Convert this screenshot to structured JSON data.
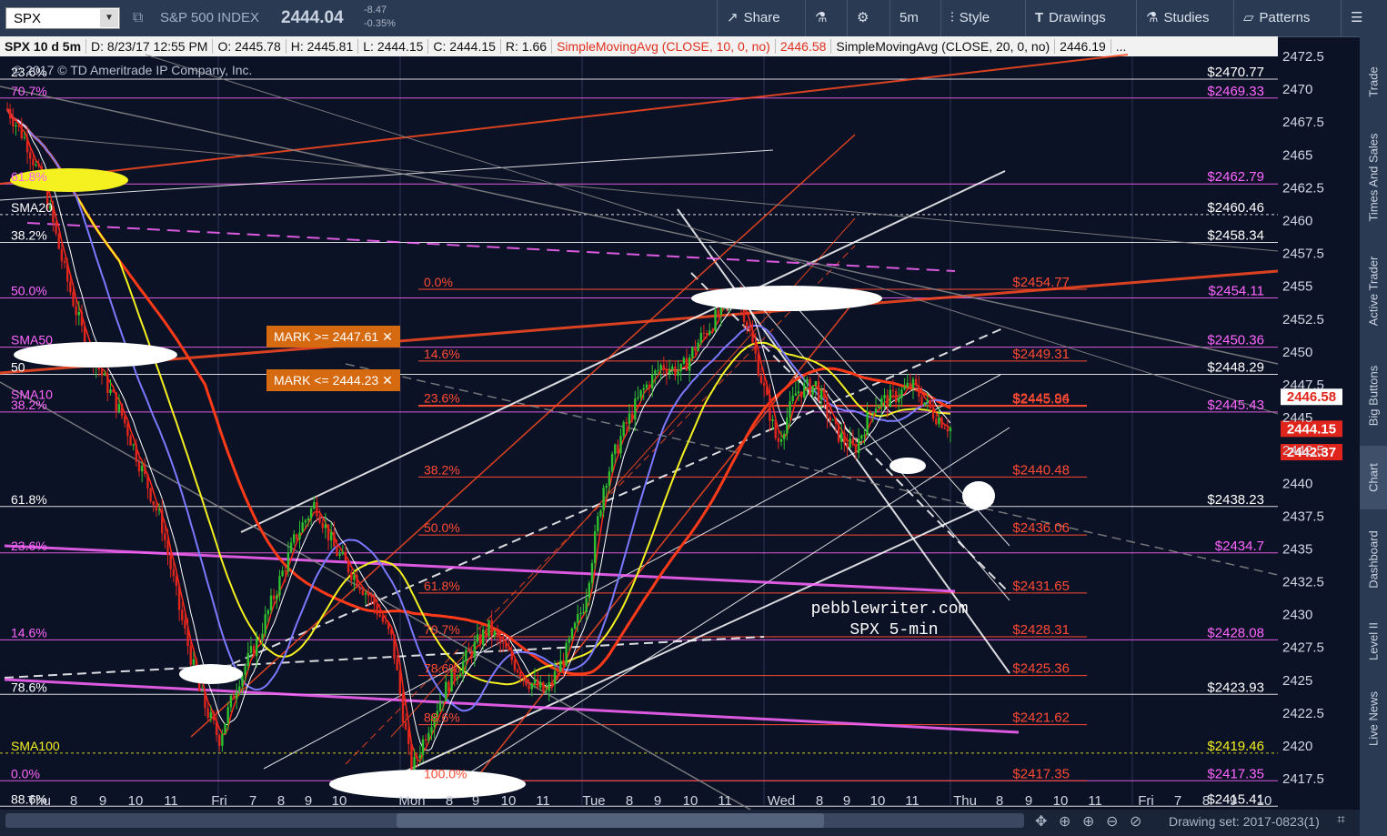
{
  "toolbar": {
    "symbol": "SPX",
    "description": "S&P 500 INDEX",
    "last": "2444.04",
    "change": "-8.47",
    "change_pct": "-0.35%",
    "buttons": {
      "share": "Share",
      "interval": "5m",
      "style": "Style",
      "drawings": "Drawings",
      "studies": "Studies",
      "patterns": "Patterns"
    }
  },
  "info_bar": {
    "symbol": "SPX 10 d 5m",
    "date": "D: 8/23/17 12:55 PM",
    "open": "O: 2445.78",
    "high": "H: 2445.81",
    "low": "L: 2444.15",
    "close": "C: 2444.15",
    "range": "R: 1.66",
    "sma10_label": "SimpleMovingAvg (CLOSE, 10, 0, no)",
    "sma10_value": "2446.58",
    "sma20_label": "SimpleMovingAvg (CLOSE, 20, 0, no)",
    "sma20_value": "2446.19",
    "more": "..."
  },
  "copyright": "© 2017 © TD Ameritrade IP Company, Inc.",
  "watermark": {
    "line1": "pebblewriter.com",
    "line2": "SPX 5-min"
  },
  "orders": {
    "upper": "MARK >= 2447.61",
    "lower": "MARK <= 2444.23"
  },
  "sidebar": [
    "Trade",
    "Times And Sales",
    "Active Trader",
    "Big Buttons",
    "Chart",
    "Dashboard",
    "Level II",
    "Live News"
  ],
  "drawing_set": "Drawing set: 2017-0823(1)",
  "colors": {
    "background": "#0c1226",
    "sma10": "#ff2a1a",
    "sma20": "#ffffff",
    "sma50": "#7b79ff",
    "sma100": "#f5f020",
    "sma_long": "#ff3a18",
    "fib_red": "#ff4a33",
    "fib_magenta": "#ff66ff",
    "bull": "#2fbf2f",
    "bear": "#e0261c",
    "order": "#d66a10"
  },
  "chart_data": {
    "type": "candlestick",
    "symbol": "SPX",
    "interval": "5m",
    "ylim": [
      2415.5,
      2472.5
    ],
    "y_ticks": [
      2417.5,
      2420,
      2422.5,
      2425,
      2427.5,
      2430,
      2432.5,
      2435,
      2437.5,
      2440,
      2442.5,
      2445,
      2447.5,
      2450,
      2452.5,
      2455,
      2457.5,
      2460,
      2462.5,
      2465,
      2467.5,
      2470,
      2472.5
    ],
    "x_labels": [
      "Thu",
      "8",
      "9",
      "10",
      "11",
      "Fri",
      "7",
      "8",
      "9",
      "10",
      "Mon",
      "8",
      "9",
      "10",
      "11",
      "Tue",
      "8",
      "9",
      "10",
      "11",
      "Wed",
      "8",
      "9",
      "10",
      "11",
      "Thu",
      "8",
      "9",
      "10",
      "11",
      "Fri",
      "7",
      "8",
      "9",
      "10"
    ],
    "price_path": [
      2468.5,
      2466,
      2462,
      2456,
      2451,
      2448,
      2445,
      2441,
      2437,
      2430,
      2424,
      2420.5,
      2425,
      2428,
      2432,
      2436,
      2438.5,
      2435,
      2433,
      2431,
      2428,
      2418,
      2422,
      2425,
      2427,
      2429,
      2427,
      2425,
      2424,
      2427,
      2431,
      2440,
      2444,
      2447,
      2449,
      2448.5,
      2451,
      2453,
      2454.5,
      2449,
      2443,
      2447,
      2447.5,
      2444,
      2442.5,
      2446,
      2446.5,
      2447.5,
      2445.5,
      2444.2
    ],
    "price_path_x_start": "Thu",
    "price_path_x_end": "Wed 12:55",
    "left_labels": [
      {
        "label": "23.6%",
        "color": "#ffffff"
      },
      {
        "label": "70.7%",
        "color": "#ff66ff"
      },
      {
        "label": "61.8%",
        "color": "#ff66ff"
      },
      {
        "label": "SMA20",
        "color": "#ffffff"
      },
      {
        "label": "38.2%",
        "color": "#ffffff"
      },
      {
        "label": "50.0%",
        "color": "#ff66ff"
      },
      {
        "label": "SMA50",
        "color": "#ff66ff"
      },
      {
        "label": "50",
        "color": "#ffffff"
      },
      {
        "label": "SMA10",
        "color": "#ff66ff"
      },
      {
        "label": "38.2%",
        "color": "#ff66ff"
      },
      {
        "label": "61.8%",
        "color": "#ffffff"
      },
      {
        "label": "23.6%",
        "color": "#ff66ff"
      },
      {
        "label": "14.6%",
        "color": "#ff66ff"
      },
      {
        "label": "78.6%",
        "color": "#ffffff"
      },
      {
        "label": "SMA100",
        "color": "#f5f020"
      },
      {
        "label": "0.0%",
        "color": "#ff66ff"
      },
      {
        "label": "88.6%",
        "color": "#ffffff"
      }
    ],
    "mid_fib_labels": [
      "0.0%",
      "14.6%",
      "23.6%",
      "38.2%",
      "50.0%",
      "61.8%",
      "70.7%",
      "78.6%",
      "88.6%",
      "100.0%"
    ],
    "red_levels": [
      {
        "value": 2454.77,
        "label": "$2454.77"
      },
      {
        "value": 2449.31,
        "label": "$2449.31"
      },
      {
        "value": 2445.86,
        "label": "$2445.86"
      },
      {
        "value": 2445.94,
        "label": "$2445.94"
      },
      {
        "value": 2440.48,
        "label": "$2440.48"
      },
      {
        "value": 2436.06,
        "label": "$2436.06"
      },
      {
        "value": 2431.65,
        "label": "$2431.65"
      },
      {
        "value": 2428.31,
        "label": "$2428.31"
      },
      {
        "value": 2425.36,
        "label": "$2425.36"
      },
      {
        "value": 2421.62,
        "label": "$2421.62"
      },
      {
        "value": 2417.35,
        "label": "$2417.35"
      }
    ],
    "right_levels": [
      {
        "value": 2470.77,
        "label": "$2470.77",
        "color": "#ffffff"
      },
      {
        "value": 2469.33,
        "label": "$2469.33",
        "color": "#ff66ff"
      },
      {
        "value": 2462.79,
        "label": "$2462.79",
        "color": "#ff66ff"
      },
      {
        "value": 2460.46,
        "label": "$2460.46",
        "color": "#ffffff"
      },
      {
        "value": 2458.34,
        "label": "$2458.34",
        "color": "#ffffff"
      },
      {
        "value": 2454.11,
        "label": "$2454.11",
        "color": "#ff66ff"
      },
      {
        "value": 2450.36,
        "label": "$2450.36",
        "color": "#ff66ff"
      },
      {
        "value": 2448.29,
        "label": "$2448.29",
        "color": "#ffffff"
      },
      {
        "value": 2445.43,
        "label": "$2445.43",
        "color": "#ff66ff"
      },
      {
        "value": 2438.23,
        "label": "$2438.23",
        "color": "#ffffff"
      },
      {
        "value": 2434.7,
        "label": "$2434.7",
        "color": "#ff66ff"
      },
      {
        "value": 2428.08,
        "label": "$2428.08",
        "color": "#ff66ff"
      },
      {
        "value": 2423.93,
        "label": "$2423.93",
        "color": "#ffffff"
      },
      {
        "value": 2419.46,
        "label": "$2419.46",
        "color": "#f5f020"
      },
      {
        "value": 2417.35,
        "label": "$2417.35",
        "color": "#ff66ff"
      },
      {
        "value": 2415.41,
        "label": "$2415.41",
        "color": "#ffffff"
      }
    ],
    "price_tags": [
      {
        "value": 2446.58,
        "label": "2446.58",
        "bg": "#ffffff",
        "fg": "#e0261c"
      },
      {
        "value": 2444.15,
        "label": "2444.15",
        "bg": "#e0261c",
        "fg": "#ffffff"
      },
      {
        "value": 2442.37,
        "label": "2442.37",
        "bg": "#e0261c",
        "fg": "#ffffff"
      }
    ]
  }
}
